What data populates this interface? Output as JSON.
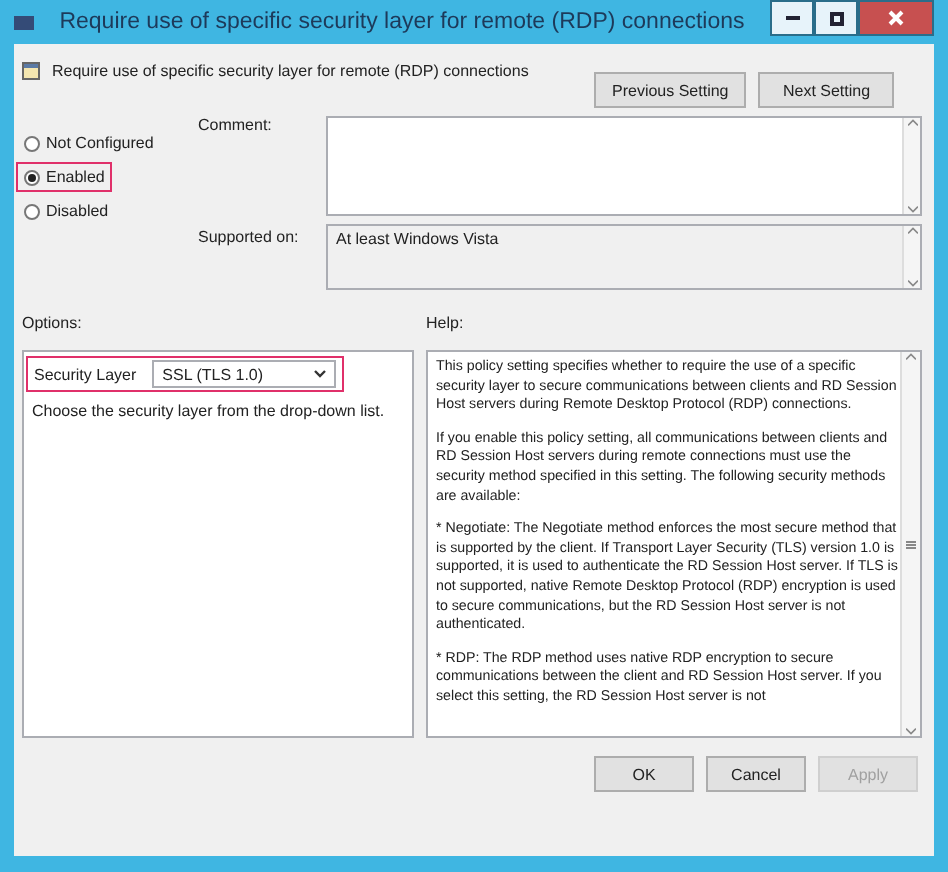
{
  "window": {
    "title": "Require use of specific security layer for remote (RDP) connections"
  },
  "header": {
    "setting_name": "Require use of specific security layer for remote (RDP) connections",
    "buttons": [
      "Previous Setting",
      "Next Setting"
    ]
  },
  "state_options": [
    {
      "label": "Not Configured",
      "selected": false,
      "highlighted": false
    },
    {
      "label": "Enabled",
      "selected": true,
      "highlighted": true
    },
    {
      "label": "Disabled",
      "selected": false,
      "highlighted": false
    }
  ],
  "comment": {
    "label": "Comment:"
  },
  "supported_on": {
    "label": "Supported on:",
    "value": "At least Windows Vista"
  },
  "options": {
    "label": "Options:",
    "field_label": "Security Layer",
    "value": "SSL (TLS 1.0)",
    "highlighted": true,
    "description": "Choose the security layer from the drop-down list."
  },
  "help": {
    "label": "Help:",
    "paragraphs": [
      "This policy setting specifies whether to require the use of a specific security layer to secure communications between clients and RD Session Host servers during Remote Desktop Protocol (RDP) connections.",
      "If you enable this policy setting, all communications between clients and RD Session Host servers during remote connections must use the security method specified in this setting. The following security methods are available:",
      "* Negotiate: The Negotiate method enforces the most secure method that is supported by the client. If Transport Layer Security (TLS) version 1.0 is supported, it is used to authenticate the RD Session Host server. If TLS is not supported, native Remote Desktop Protocol (RDP) encryption is used to secure communications, but the RD Session Host server is not authenticated.",
      "* RDP: The RDP method uses native RDP encryption to secure communications between the client and RD Session Host server. If you select this setting, the RD Session Host server is not"
    ]
  },
  "footer_buttons": [
    {
      "label": "OK",
      "disabled": false
    },
    {
      "label": "Cancel",
      "disabled": false
    },
    {
      "label": "Apply",
      "disabled": true
    }
  ]
}
